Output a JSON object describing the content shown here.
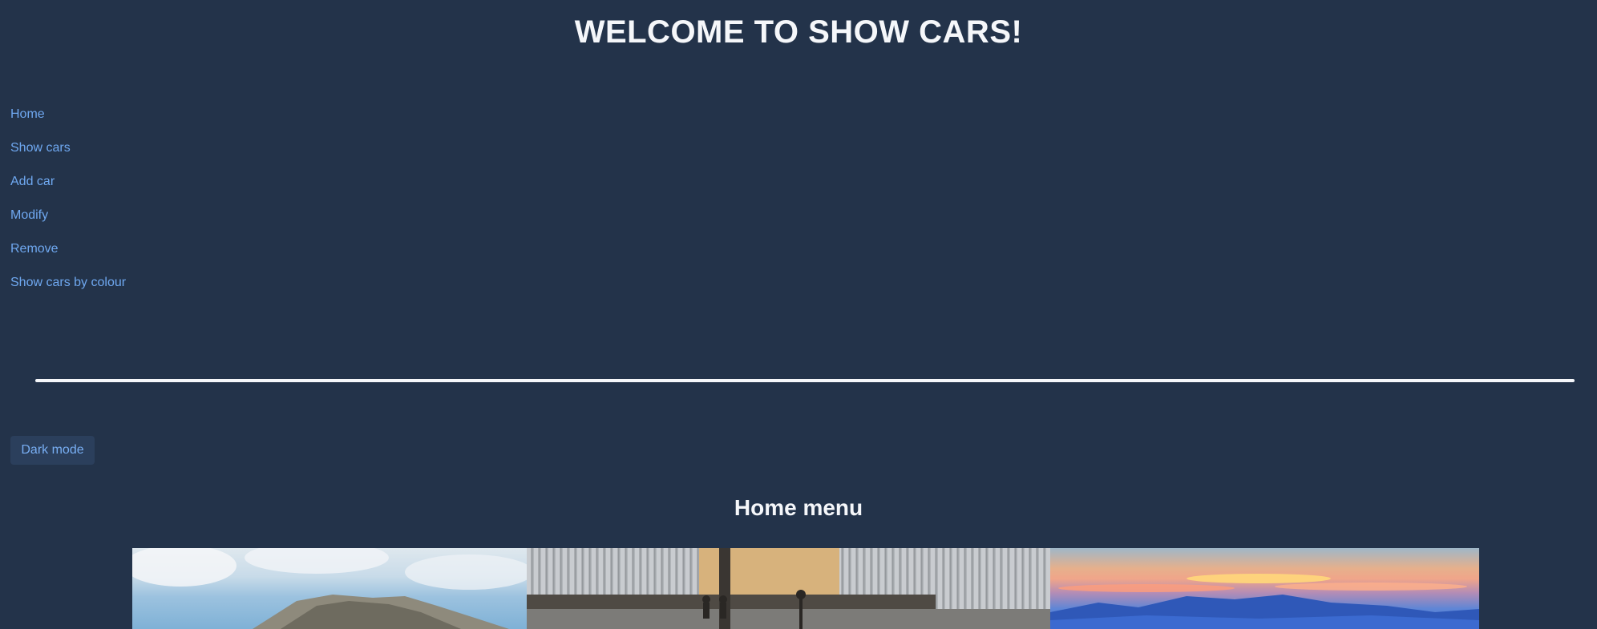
{
  "header": {
    "title": "WELCOME TO SHOW CARS!"
  },
  "nav": {
    "items": [
      {
        "label": "Home"
      },
      {
        "label": "Show cars"
      },
      {
        "label": "Add car"
      },
      {
        "label": "Modify"
      },
      {
        "label": "Remove"
      },
      {
        "label": "Show cars by colour"
      }
    ]
  },
  "controls": {
    "dark_mode_label": "Dark mode"
  },
  "main": {
    "heading": "Home menu",
    "gallery": [
      {
        "subject": "mountain-landscape"
      },
      {
        "subject": "building-facade"
      },
      {
        "subject": "sunset-over-mountains"
      }
    ]
  },
  "colors": {
    "background": "#23334a",
    "link": "#6fa8f0",
    "text": "#f5f7fa",
    "button_bg": "#2b3f5c"
  }
}
